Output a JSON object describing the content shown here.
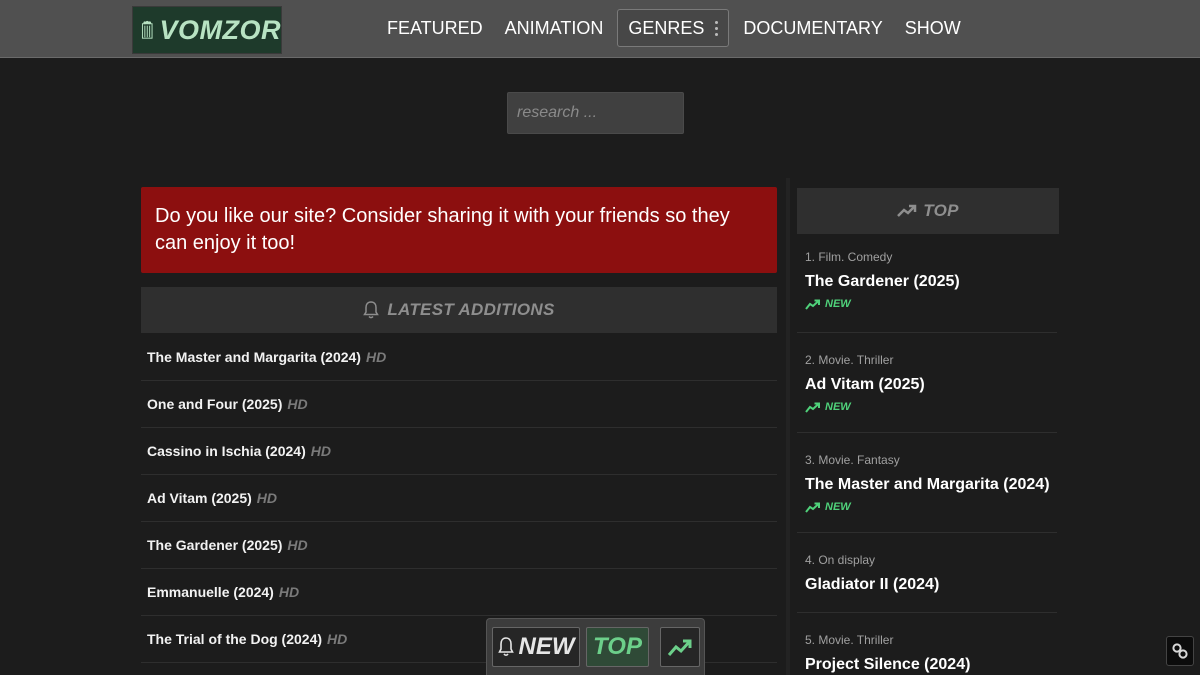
{
  "brand": {
    "name": "VOMZOR"
  },
  "nav": {
    "items": [
      "FEATURED",
      "ANIMATION",
      "GENRES",
      "DOCUMENTARY",
      "SHOW"
    ]
  },
  "search": {
    "placeholder": "research ...",
    "value": ""
  },
  "share_banner": {
    "text": "Do you like our site? Consider sharing it with your friends so they can enjoy it too!"
  },
  "latest": {
    "heading": "LATEST ADDITIONS",
    "items": [
      {
        "title": "The Master and Margarita (2024)",
        "quality": "HD"
      },
      {
        "title": "One and Four (2025)",
        "quality": "HD"
      },
      {
        "title": "Cassino in Ischia (2024)",
        "quality": "HD"
      },
      {
        "title": "Ad Vitam (2025)",
        "quality": "HD"
      },
      {
        "title": "The Gardener (2025)",
        "quality": "HD"
      },
      {
        "title": "Emmanuelle (2024)",
        "quality": "HD"
      },
      {
        "title": "The Trial of the Dog (2024)",
        "quality": "HD"
      }
    ]
  },
  "top": {
    "heading": "TOP",
    "items": [
      {
        "category": "1. Film. Comedy",
        "title": "The Gardener (2025)",
        "badge": "NEW"
      },
      {
        "category": "2. Movie. Thriller",
        "title": "Ad Vitam (2025)",
        "badge": "NEW"
      },
      {
        "category": "3. Movie. Fantasy",
        "title": "The Master and Margarita (2024)",
        "badge": "NEW"
      },
      {
        "category": "4. On display",
        "title": "Gladiator II (2024)",
        "badge": ""
      },
      {
        "category": "5. Movie. Thriller",
        "title": "Project Silence (2024)",
        "badge": ""
      }
    ]
  },
  "floating_bar": {
    "new_label": "NEW",
    "top_label": "TOP"
  },
  "colors": {
    "background": "#1c1c1c",
    "header": "#505050",
    "banner": "#8c0f0f",
    "accent_green": "#4fd17a"
  }
}
